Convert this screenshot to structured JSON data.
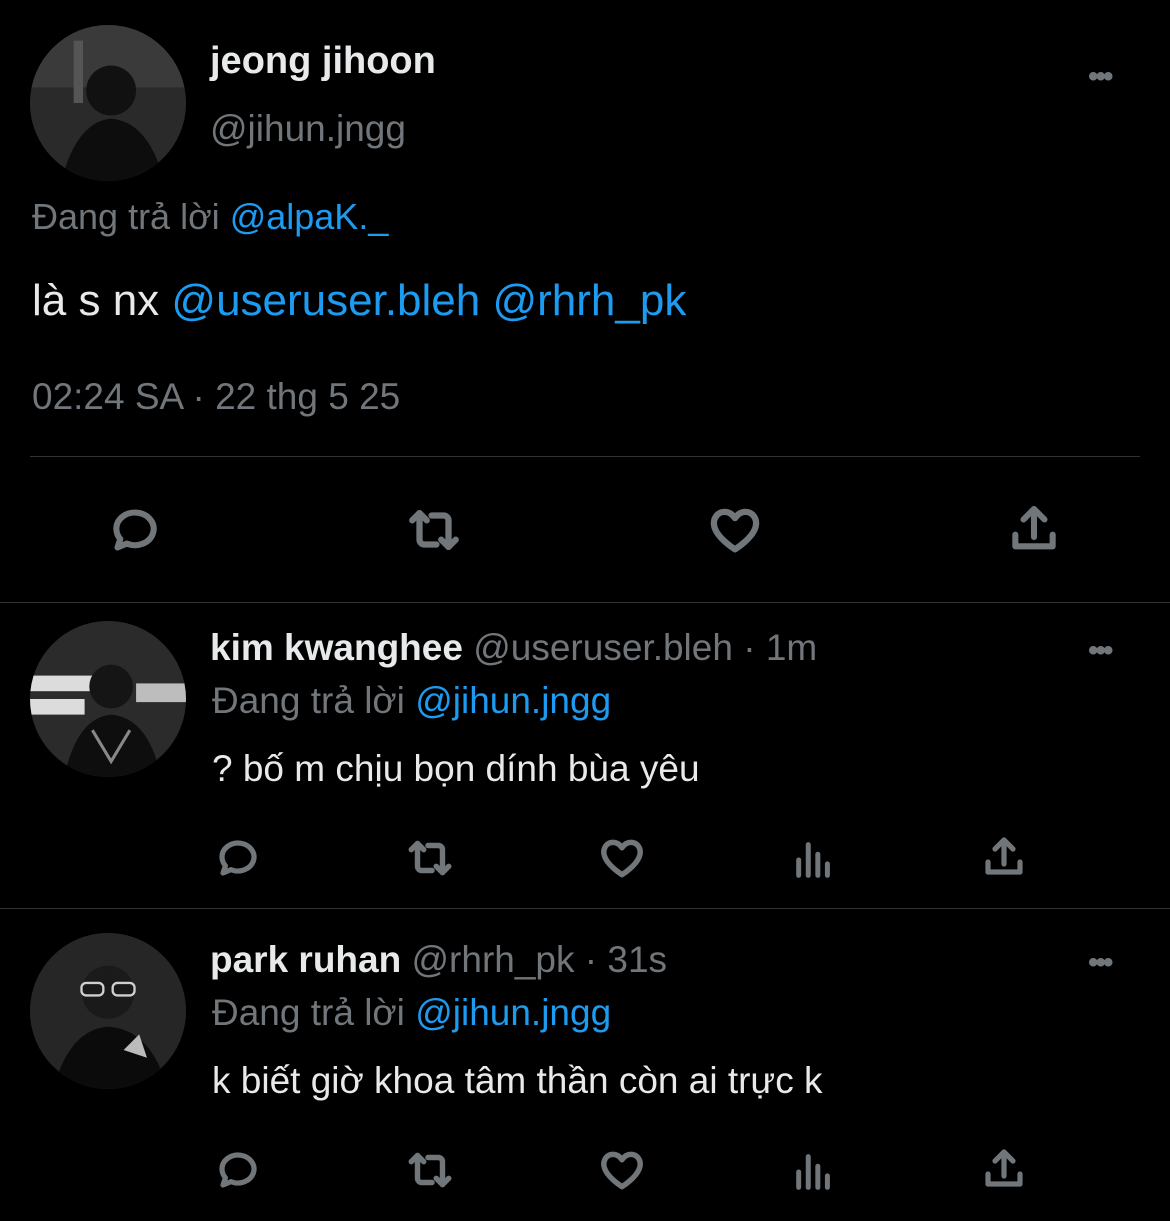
{
  "main_tweet": {
    "display_name": "jeong jihoon",
    "handle": "@jihun.jngg",
    "replying_prefix": "Đang trả lời",
    "replying_to": "@alpaK._",
    "text_plain": "là s nx",
    "mention_1": "@useruser.bleh",
    "mention_2": "@rhrh_pk",
    "timestamp": "02:24 SA · 22 thg 5 25",
    "more_label": "•••"
  },
  "replies": [
    {
      "display_name": "kim kwanghee",
      "handle": "@useruser.bleh",
      "separator": "·",
      "age": "1m",
      "replying_prefix": "Đang trả lời",
      "replying_to": "@jihun.jngg",
      "text": "? bố m chịu bọn dính bùa yêu",
      "more_label": "•••"
    },
    {
      "display_name": "park ruhan",
      "handle": "@rhrh_pk",
      "separator": "·",
      "age": "31s",
      "replying_prefix": "Đang trả lời",
      "replying_to": "@jihun.jngg",
      "text": "k biết giờ khoa tâm thần còn ai trực k",
      "more_label": "•••"
    }
  ],
  "icons": [
    "reply-icon",
    "retweet-icon",
    "like-icon",
    "views-icon",
    "share-icon",
    "more-icon"
  ],
  "colors": {
    "background": "#000000",
    "text": "#e7e9ea",
    "secondary": "#71767b",
    "link": "#1d9bf0",
    "divider": "#2f3336"
  }
}
